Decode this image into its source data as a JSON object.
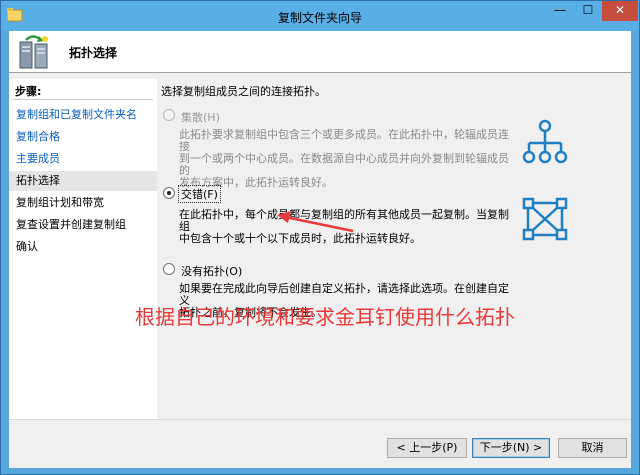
{
  "window": {
    "title": "复制文件夹向导",
    "controls": {
      "minimize": "—",
      "maximize": "☐",
      "close": "✕"
    }
  },
  "header": {
    "title": "拓扑选择"
  },
  "steps": {
    "title": "步骤:",
    "items": [
      {
        "label": "复制组和已复制文件夹名",
        "state": "link"
      },
      {
        "label": "复制合格",
        "state": "link"
      },
      {
        "label": "主要成员",
        "state": "link"
      },
      {
        "label": "拓扑选择",
        "state": "current"
      },
      {
        "label": "复制组计划和带宽",
        "state": "normal"
      },
      {
        "label": "复查设置并创建复制组",
        "state": "normal"
      },
      {
        "label": "确认",
        "state": "normal"
      }
    ]
  },
  "content": {
    "intro": "选择复制组成员之间的连接拓扑。",
    "options": [
      {
        "label": "集散(H)",
        "selected": false,
        "enabled": false,
        "description": [
          "此拓扑要求复制组中包含三个或更多成员。在此拓扑中，轮辐成员连接",
          "到一个或两个中心成员。在数据源自中心成员并向外复制到轮辐成员的",
          "发布方案中，此拓扑运转良好。"
        ],
        "icon": "hub-spoke-topology-icon"
      },
      {
        "label": "交错(F)",
        "selected": true,
        "enabled": true,
        "description": [
          "在此拓扑中，每个成员都与复制组的所有其他成员一起复制。当复制组",
          "中包含十个或十个以下成员时，此拓扑运转良好。"
        ],
        "icon": "full-mesh-topology-icon"
      },
      {
        "label": "没有拓扑(O)",
        "selected": false,
        "enabled": true,
        "description": [
          "如果要在完成此向导后创建自定义拓扑，请选择此选项。在创建自定义",
          "拓扑之前，复制将不会发生。"
        ],
        "icon": ""
      }
    ]
  },
  "annotation": "根据自己的环境和要求金耳钉使用什么拓扑",
  "buttons": {
    "back": "< 上一步(P)",
    "next": "下一步(N) >",
    "cancel": "取消"
  },
  "colors": {
    "link": "#0b5fbc",
    "icon": "#1e7fc6",
    "annotation": "#e83a3a",
    "title_bar": "#5aaee6"
  }
}
